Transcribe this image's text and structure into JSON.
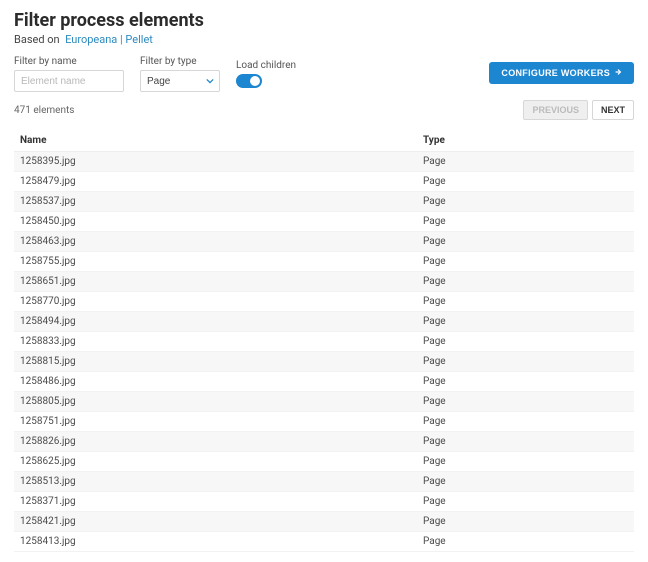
{
  "header": {
    "title": "Filter process elements",
    "based_on_prefix": "Based on",
    "project_name": "Europeana | Pellet"
  },
  "filters": {
    "name_label": "Filter by name",
    "name_placeholder": "Element name",
    "type_label": "Filter by type",
    "type_value": "Page",
    "load_children_label": "Load children"
  },
  "actions": {
    "configure_workers": "CONFIGURE WORKERS"
  },
  "pager": {
    "count_text": "471 elements",
    "previous": "PREVIOUS",
    "next": "NEXT"
  },
  "table": {
    "col_name": "Name",
    "col_type": "Type",
    "rows": [
      {
        "name": "1258395.jpg",
        "type": "Page"
      },
      {
        "name": "1258479.jpg",
        "type": "Page"
      },
      {
        "name": "1258537.jpg",
        "type": "Page"
      },
      {
        "name": "1258450.jpg",
        "type": "Page"
      },
      {
        "name": "1258463.jpg",
        "type": "Page"
      },
      {
        "name": "1258755.jpg",
        "type": "Page"
      },
      {
        "name": "1258651.jpg",
        "type": "Page"
      },
      {
        "name": "1258770.jpg",
        "type": "Page"
      },
      {
        "name": "1258494.jpg",
        "type": "Page"
      },
      {
        "name": "1258833.jpg",
        "type": "Page"
      },
      {
        "name": "1258815.jpg",
        "type": "Page"
      },
      {
        "name": "1258486.jpg",
        "type": "Page"
      },
      {
        "name": "1258805.jpg",
        "type": "Page"
      },
      {
        "name": "1258751.jpg",
        "type": "Page"
      },
      {
        "name": "1258826.jpg",
        "type": "Page"
      },
      {
        "name": "1258625.jpg",
        "type": "Page"
      },
      {
        "name": "1258513.jpg",
        "type": "Page"
      },
      {
        "name": "1258371.jpg",
        "type": "Page"
      },
      {
        "name": "1258421.jpg",
        "type": "Page"
      },
      {
        "name": "1258413.jpg",
        "type": "Page"
      }
    ]
  }
}
